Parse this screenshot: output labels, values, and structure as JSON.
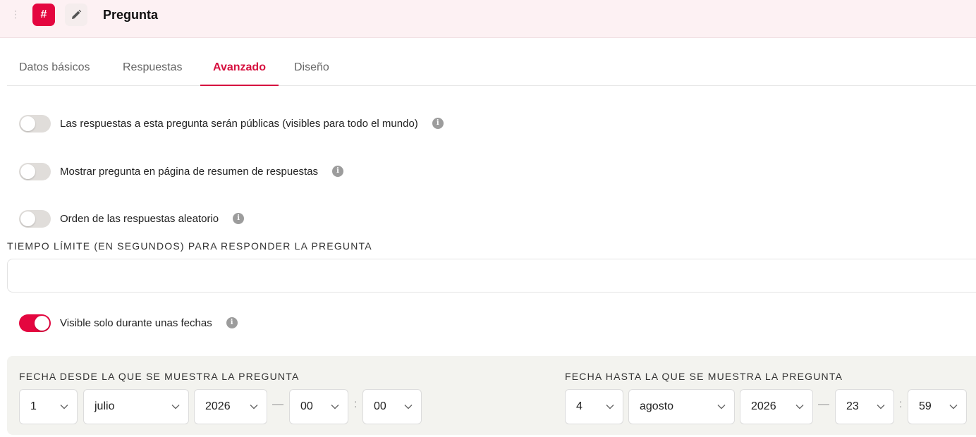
{
  "header": {
    "drag_glyph": "⋮",
    "badge": "#",
    "title": "Pregunta"
  },
  "tabs": [
    {
      "label": "Datos básicos",
      "active": false
    },
    {
      "label": "Respuestas",
      "active": false
    },
    {
      "label": "Avanzado",
      "active": true
    },
    {
      "label": "Diseño",
      "active": false
    }
  ],
  "toggles": [
    {
      "label": "Las respuestas a esta pregunta serán públicas (visibles para todo el mundo)",
      "on": false
    },
    {
      "label": "Mostrar pregunta en página de resumen de respuestas",
      "on": false
    },
    {
      "label": "Orden de las respuestas aleatorio",
      "on": false
    },
    {
      "label": "Visible solo durante unas fechas",
      "on": true
    }
  ],
  "info_glyph": "i",
  "time_limit": {
    "label": "TIEMPO LÍMITE (EN SEGUNDOS) PARA RESPONDER LA PREGUNTA",
    "value": ""
  },
  "date_from": {
    "label": "FECHA DESDE LA QUE SE MUESTRA LA PREGUNTA",
    "day": "1",
    "month": "julio",
    "year": "2026",
    "hour": "00",
    "minute": "00"
  },
  "date_to": {
    "label": "FECHA HASTA LA QUE SE MUESTRA LA PREGUNTA",
    "day": "4",
    "month": "agosto",
    "year": "2026",
    "hour": "23",
    "minute": "59"
  },
  "separators": {
    "dash": "—",
    "colon": ":"
  },
  "colors": {
    "accent": "#e4063f",
    "header_bg": "#fdf1f3",
    "panel_bg": "#f3f3ef"
  }
}
